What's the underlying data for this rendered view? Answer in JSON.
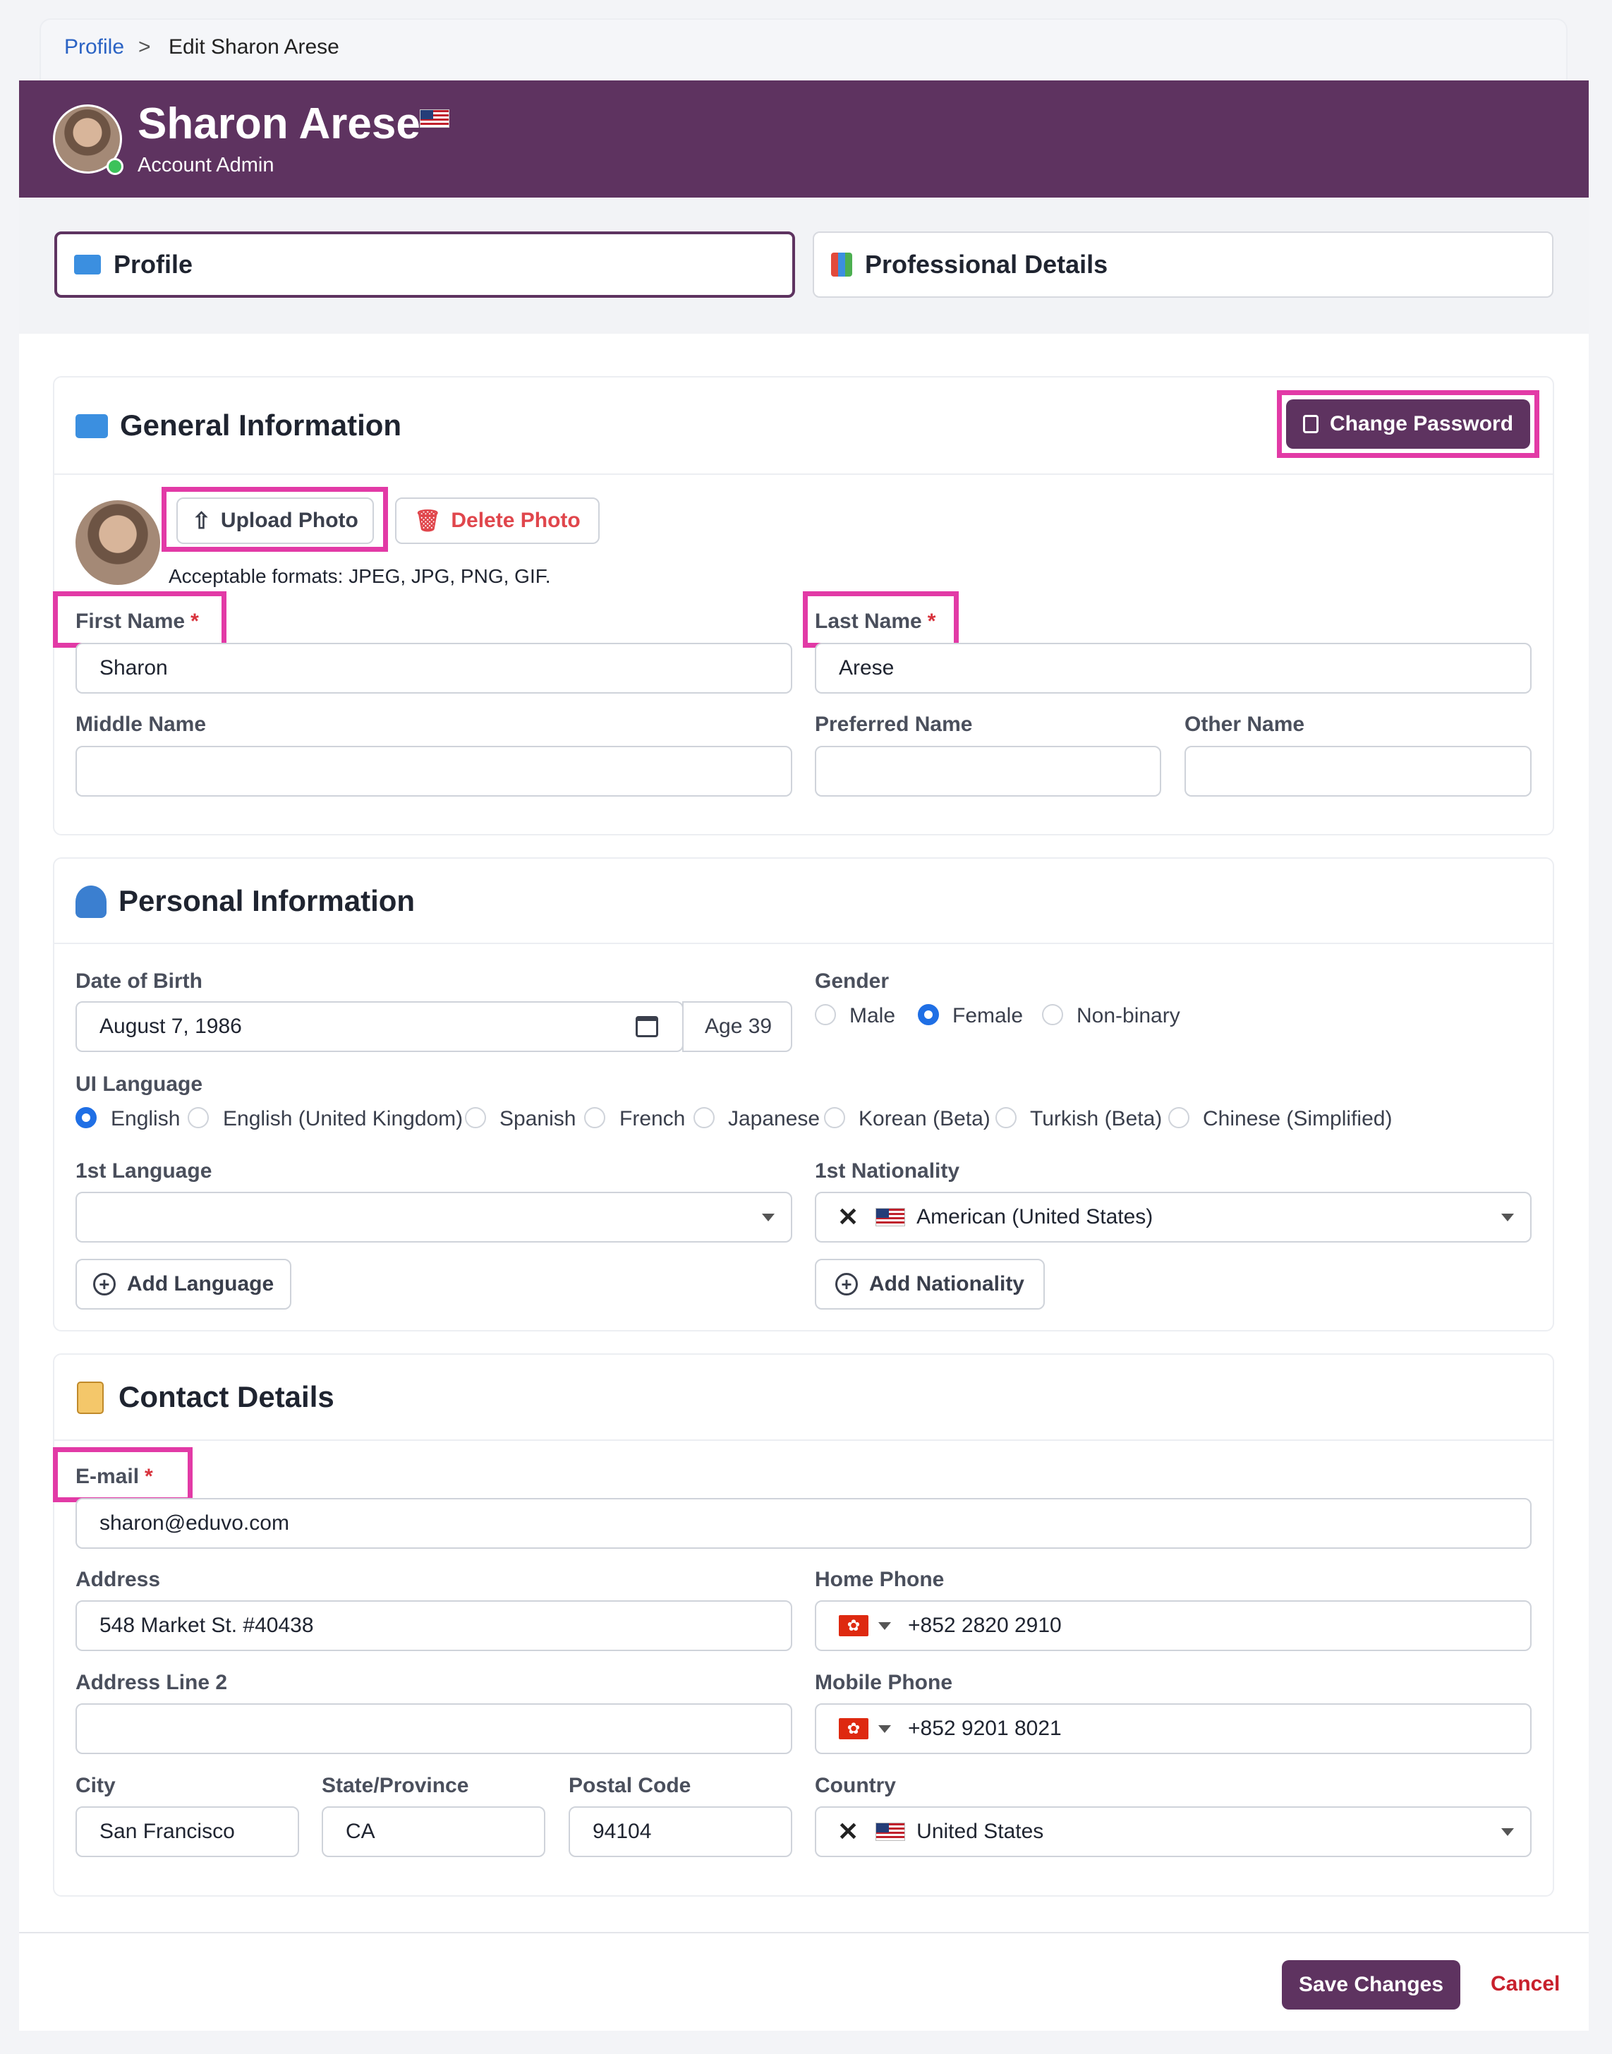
{
  "breadcrumb": {
    "root": "Profile",
    "separator": ">",
    "current": "Edit Sharon Arese"
  },
  "header": {
    "name": "Sharon Arese",
    "role": "Account Admin"
  },
  "tabs": [
    {
      "label": "Profile"
    },
    {
      "label": "Professional Details"
    }
  ],
  "general": {
    "title": "General Information",
    "change_password": "Change Password",
    "upload_photo": "Upload Photo",
    "delete_photo": "Delete Photo",
    "formats": "Acceptable formats: JPEG, JPG, PNG, GIF.",
    "first_name_label": "First Name",
    "first_name_value": "Sharon",
    "last_name_label": "Last Name",
    "last_name_value": "Arese",
    "middle_name_label": "Middle Name",
    "preferred_name_label": "Preferred Name",
    "other_name_label": "Other Name",
    "required_mark": "*"
  },
  "personal": {
    "title": "Personal Information",
    "dob_label": "Date of Birth",
    "dob_value": "August 7, 1986",
    "age": "Age 39",
    "gender_label": "Gender",
    "gender_options": [
      "Male",
      "Female",
      "Non-binary"
    ],
    "gender_selected": "Female",
    "ui_language_label": "UI Language",
    "ui_languages": [
      "English",
      "English (United Kingdom)",
      "Spanish",
      "French",
      "Japanese",
      "Korean (Beta)",
      "Turkish (Beta)",
      "Chinese (Simplified)"
    ],
    "ui_language_selected": "English",
    "first_language_label": "1st Language",
    "first_language_value": "",
    "first_nationality_label": "1st Nationality",
    "first_nationality_value": "American (United States)",
    "add_language": "Add Language",
    "add_nationality": "Add Nationality"
  },
  "contact": {
    "title": "Contact Details",
    "email_label": "E-mail",
    "email_value": "sharon@eduvo.com",
    "address_label": "Address",
    "address_value": "548 Market St. #40438",
    "address2_label": "Address Line 2",
    "home_phone_label": "Home Phone",
    "home_phone_value": "+852 2820 2910",
    "mobile_phone_label": "Mobile Phone",
    "mobile_phone_value": "+852 9201 8021",
    "city_label": "City",
    "city_value": "San Francisco",
    "state_label": "State/Province",
    "state_value": "CA",
    "postal_label": "Postal Code",
    "postal_value": "94104",
    "country_label": "Country",
    "country_value": "United States"
  },
  "footer": {
    "save": "Save Changes",
    "cancel": "Cancel"
  },
  "colors": {
    "brand": "#5e3360",
    "highlight": "#e23aa6",
    "link": "#2b63c4",
    "danger": "#d8323c"
  }
}
